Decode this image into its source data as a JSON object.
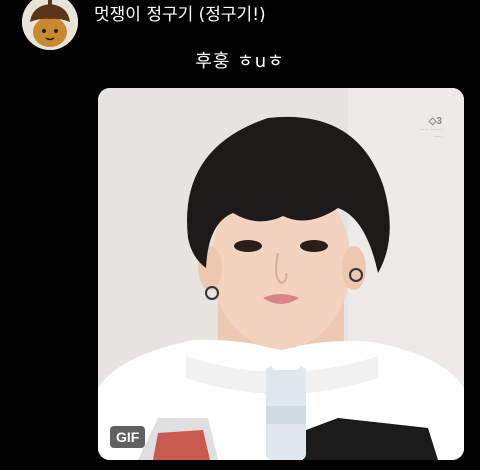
{
  "post": {
    "author_name": "멋쟁이 정구기 (정구기!)",
    "caption": "후훙 ㅎuㅎ",
    "media_badge": "GIF"
  },
  "icons": {
    "avatar": "acorn-character-icon"
  },
  "colors": {
    "background": "#000000",
    "text": "#ffffff",
    "badge_bg": "#000000"
  }
}
